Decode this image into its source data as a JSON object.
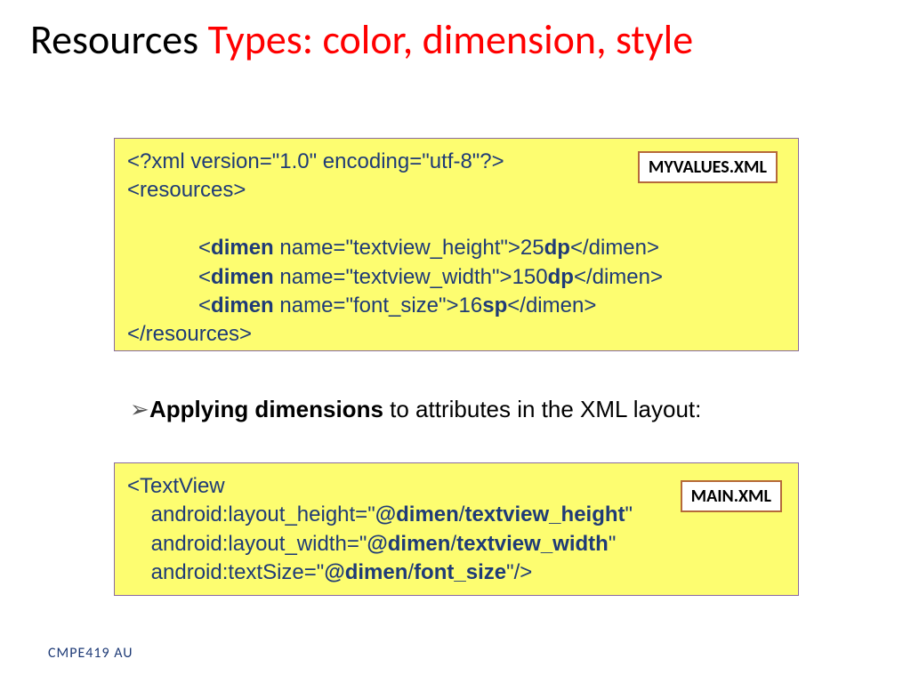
{
  "title": {
    "black": "Resources ",
    "red": "Types: color, dimension, style"
  },
  "box1": {
    "tag": "MYVALUES.XML",
    "l1": "<?xml version=\"1.0\" encoding=\"utf-8\"?>",
    "l2": "<resources>",
    "d1a": "            <",
    "d1b": "dimen",
    "d1c": " name=\"textview_height\">25",
    "d1d": "dp",
    "d1e": "</dimen>",
    "d2a": "            <",
    "d2b": "dimen",
    "d2c": " name=\"textview_width\">150",
    "d2d": "dp",
    "d2e": "</dimen>",
    "d3a": "            <",
    "d3b": "dimen",
    "d3c": " name=\"font_size\">16",
    "d3d": "sp",
    "d3e": "</dimen>",
    "l6": "</resources>"
  },
  "mid": {
    "chev": "➢ ",
    "bold": "Applying dimensions",
    "rest": " to attributes in the XML layout:"
  },
  "box2": {
    "tag": "MAIN.XML",
    "l1": "<TextView",
    "a1a": "    android:layout_height=\"",
    "a1b": "@dimen",
    "a1s": "/",
    "a1c": "textview_height",
    "a1d": "\"",
    "a2a": "    android:layout_width=\"",
    "a2b": "@dimen",
    "a2s": "/",
    "a2c": "textview_width",
    "a2d": "\"",
    "a3a": "    android:textSize=\"",
    "a3b": "@dimen",
    "a3s": "/",
    "a3c": "font_size",
    "a3d": "\"/>"
  },
  "footer": "CMPE419 AU"
}
